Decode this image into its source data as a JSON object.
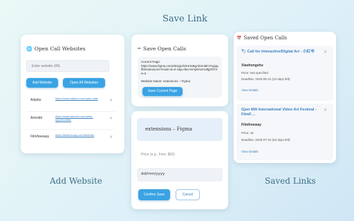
{
  "captions": {
    "top": "Save Link",
    "left": "Add Website",
    "right": "Saved Links"
  },
  "add_panel": {
    "title": "Open Call Websites",
    "input_placeholder": "Enter website URL",
    "add_button": "Add Website",
    "open_all_button": "Open All Websites",
    "sites": [
      {
        "name": "Artjobs",
        "url": "https://www.artjobs.com/open-calls"
      },
      {
        "name": "Artsobit",
        "url": "https://www.artsobit.com/artist-opportunities"
      },
      {
        "name": "Filmfreeway",
        "url": "https://filmfreeway.com/festivals"
      }
    ]
  },
  "save_panel": {
    "title": "Save Open Calls",
    "current_page_label": "Current Page:",
    "current_url": "https://www.figma.com/design/SlAKmBgAbmnkEYHyjqqifb/extensions?node-id=0-1&p=f&t=NrAjMA2HU8jjX07XH-0",
    "website_name_line": "Website Name: extensions – Figma",
    "save_button": "Save Current Page"
  },
  "form_panel": {
    "page_title": "extensions – Figma",
    "price_placeholder": "Price (e.g., Free, $50)",
    "date_placeholder": "dd/mm/yyyy",
    "confirm_button": "Confirm Save",
    "cancel_button": "Cancel"
  },
  "saved_panel": {
    "title": "Saved Open Calls",
    "items": [
      {
        "title": "Call for Interactive/Digital Art - 小红书",
        "source": "Xiaohongshu",
        "price": "Price: Not specified",
        "deadline": "Deadline: 2025-05-31 (23 days left)",
        "link": "View Details"
      },
      {
        "title": "Gjon Mili International Video Art Festival - FilmF…",
        "source": "Filmfreeway",
        "price": "Price: 15",
        "deadline": "Deadline: 2025-07-10 (63 days left)",
        "link": "View Details"
      }
    ]
  },
  "colors": {
    "accent": "#3aa3e3",
    "link": "#3a7fc0",
    "saved_title": "#3a7fc0",
    "background_start": "#eaf8f6",
    "background_end": "#cfe6f5"
  }
}
